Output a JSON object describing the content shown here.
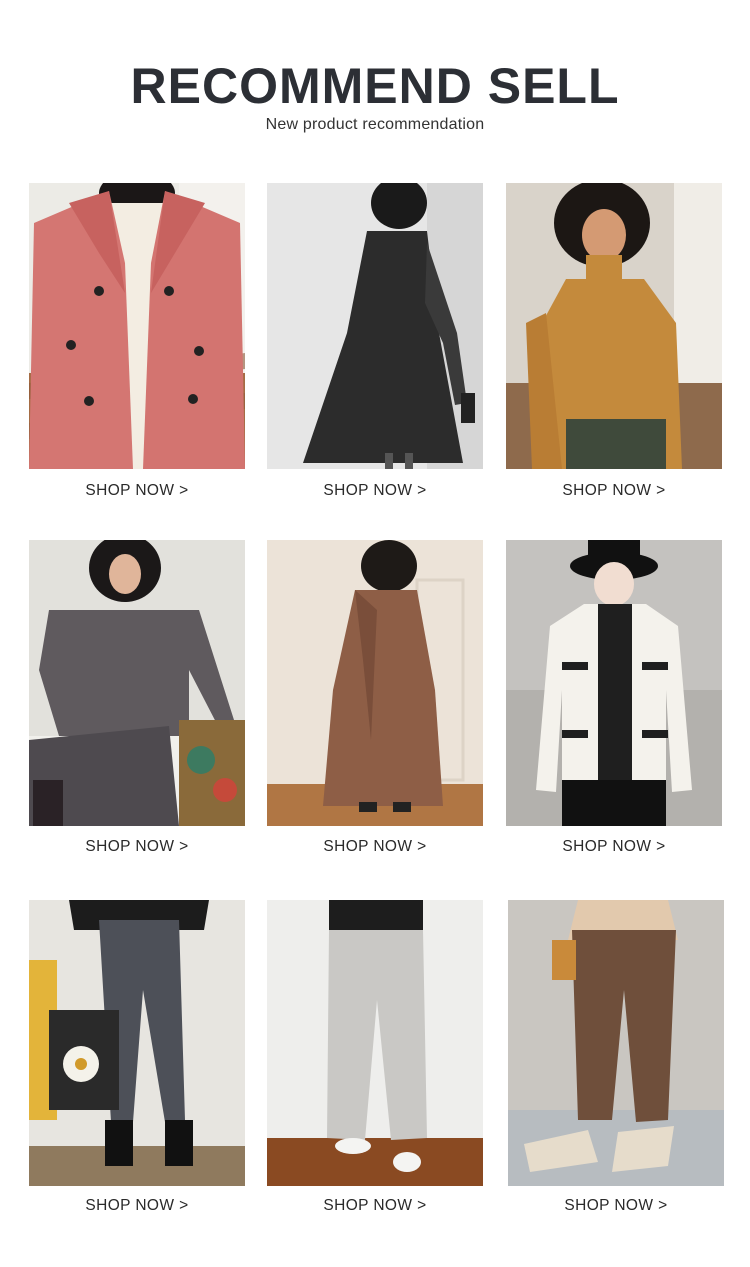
{
  "header": {
    "title": "RECOMMEND SELL",
    "subtitle": "New product recommendation"
  },
  "products": [
    {
      "label": "SHOP NOW >",
      "image": "woman in pink double-breasted wool coat"
    },
    {
      "label": "SHOP NOW >",
      "image": "woman in black flared dress, black and white photo"
    },
    {
      "label": "SHOP NOW >",
      "image": "woman in mustard turtleneck sweater"
    },
    {
      "label": "SHOP NOW >",
      "image": "woman in grey sweatshirt sitting"
    },
    {
      "label": "SHOP NOW >",
      "image": "woman in long brown coat"
    },
    {
      "label": "SHOP NOW >",
      "image": "woman in black hat and white cardigan"
    },
    {
      "label": "SHOP NOW >",
      "image": "woman in grey denim jeans with tote bag"
    },
    {
      "label": "SHOP NOW >",
      "image": "light grey wide-leg trousers"
    },
    {
      "label": "SHOP NOW >",
      "image": "brown tapered trousers with cream boots"
    }
  ]
}
